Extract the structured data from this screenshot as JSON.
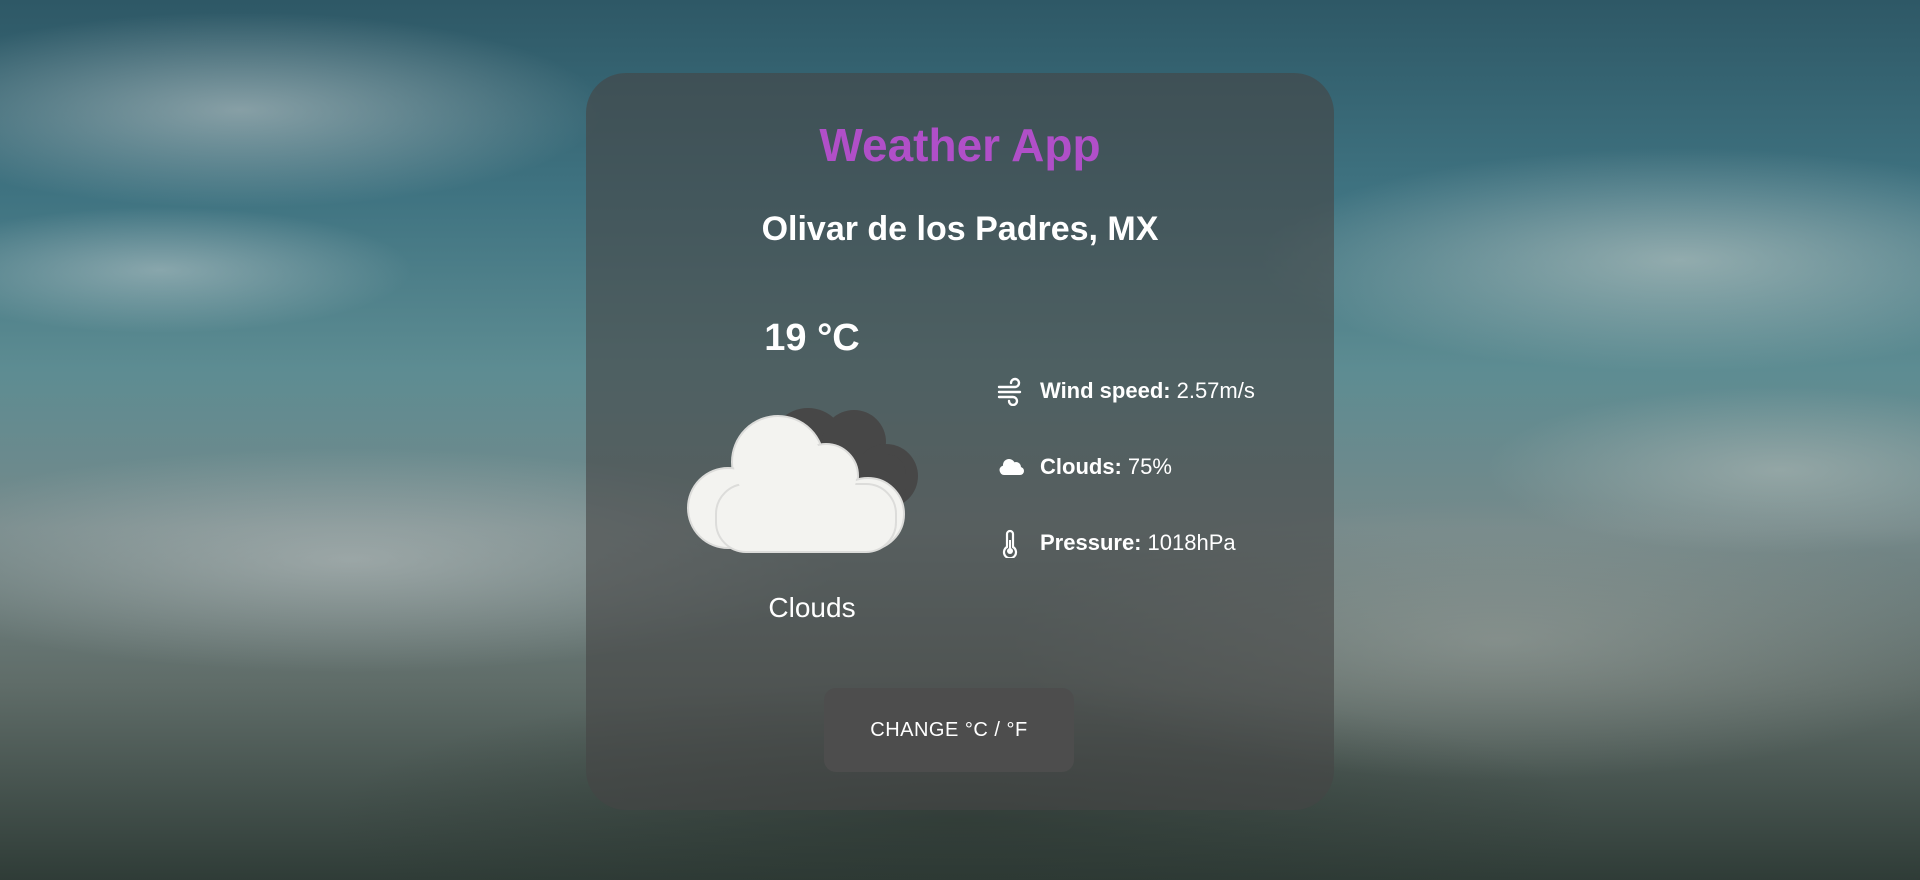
{
  "app": {
    "title": "Weather App"
  },
  "location": {
    "city": "Olivar de los Padres, MX"
  },
  "current": {
    "temperature": "19 °C",
    "condition": "Clouds",
    "icon": "cloud-icon"
  },
  "stats": [
    {
      "icon": "wind-icon",
      "label": "Wind speed:",
      "value": "2.57m/s"
    },
    {
      "icon": "cloud-icon",
      "label": "Clouds:",
      "value": "75%"
    },
    {
      "icon": "thermometer-icon",
      "label": "Pressure:",
      "value": "1018hPa"
    }
  ],
  "actions": {
    "toggle_units_label": "CHANGE °C / °F"
  },
  "colors": {
    "title": "#b04fc8",
    "card_background": "rgba(70,70,70,0.62)",
    "button_background": "#4d4d4d",
    "text": "#ffffff"
  }
}
